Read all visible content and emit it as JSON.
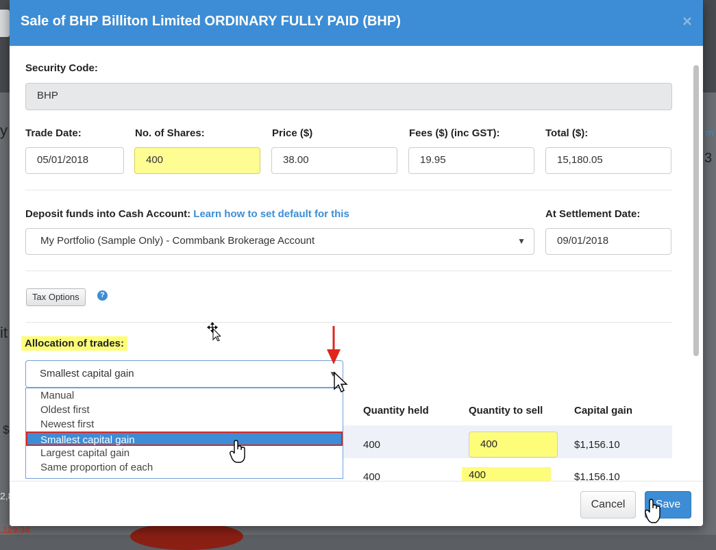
{
  "background": {
    "fragment_a": "y",
    "fragment_b": "it",
    "fragment_c": "$",
    "fragment_d": "2,8",
    "fragment_e": ",129.34",
    "fragment_f": "3",
    "fragment_g": "rn"
  },
  "modal": {
    "title": "Sale of BHP Billiton Limited ORDINARY FULLY PAID (BHP)",
    "close_glyph": "×"
  },
  "form": {
    "security_code_label": "Security Code:",
    "security_code_value": "BHP",
    "trade_date_label": "Trade Date:",
    "trade_date_value": "05/01/2018",
    "shares_label": "No. of Shares:",
    "shares_value": "400",
    "price_label": "Price ($)",
    "price_value": "38.00",
    "fees_label": "Fees ($) (inc GST):",
    "fees_value": "19.95",
    "total_label": "Total ($):",
    "total_value": "15,180.05",
    "deposit_label": "Deposit funds into Cash Account:",
    "deposit_link": "Learn how to set default for this",
    "deposit_value": "My Portfolio (Sample Only) - Commbank Brokerage Account",
    "settlement_label": "At Settlement Date:",
    "settlement_value": "09/01/2018",
    "tax_options_label": "Tax Options",
    "help_glyph": "?"
  },
  "allocation": {
    "label": "Allocation of trades:",
    "selected": "Smallest capital gain",
    "arrow_glyph": "▼",
    "options": [
      "Manual",
      "Oldest first",
      "Newest first",
      "Smallest capital gain",
      "Largest capital gain",
      "Same proportion of each"
    ]
  },
  "table": {
    "headers": [
      "Quantity held",
      "Quantity to sell",
      "Capital gain"
    ],
    "rows": [
      {
        "held": "400",
        "sell": "400",
        "gain": "$1,156.10"
      },
      {
        "held": "400",
        "sell": "400",
        "gain": "$1,156.10"
      }
    ]
  },
  "footer": {
    "cancel_label": "Cancel",
    "save_label": "Save"
  },
  "colors": {
    "header_blue": "#3c8dd5",
    "highlight_yellow": "#fdfd7a",
    "annotation_red": "#e0241c"
  }
}
